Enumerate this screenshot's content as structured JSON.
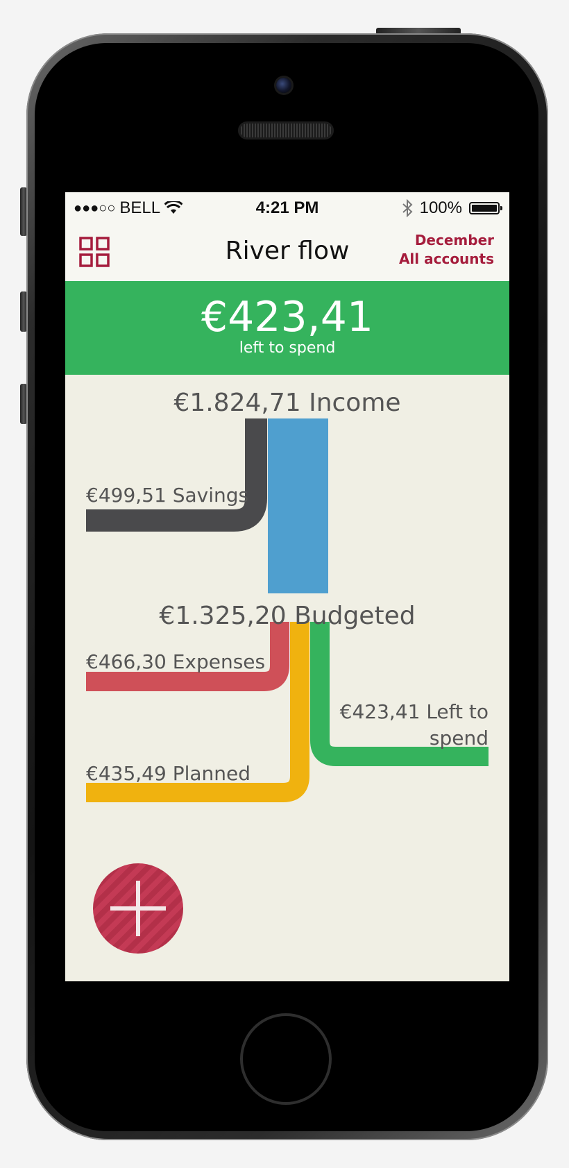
{
  "status_bar": {
    "signal": "●●●○○",
    "carrier": "BELL",
    "time": "4:21 PM",
    "battery": "100%",
    "icons": [
      "wifi-icon",
      "bluetooth-icon",
      "battery-icon"
    ]
  },
  "nav": {
    "title": "River flow",
    "month": "December",
    "accounts": "All accounts",
    "menu_icon": "grid-icon"
  },
  "banner": {
    "amount": "€423,41",
    "caption": "left to spend"
  },
  "flow": {
    "income": "€1.824,71 Income",
    "savings": "€499,51 Savings",
    "budgeted": "€1.325,20 Budgeted",
    "expenses": "€466,30 Expenses",
    "left_line1": "€423,41 Left to",
    "left_line2": "spend",
    "planned": "€435,49 Planned"
  },
  "fab": {
    "icon": "plus-icon"
  },
  "colors": {
    "accent": "#a51c3c",
    "green": "#35b35d",
    "savings": "#4a4a4c",
    "budget": "#4f9fcf",
    "expenses": "#cf5058",
    "planned": "#f0b20f",
    "background": "#f0efe4"
  }
}
